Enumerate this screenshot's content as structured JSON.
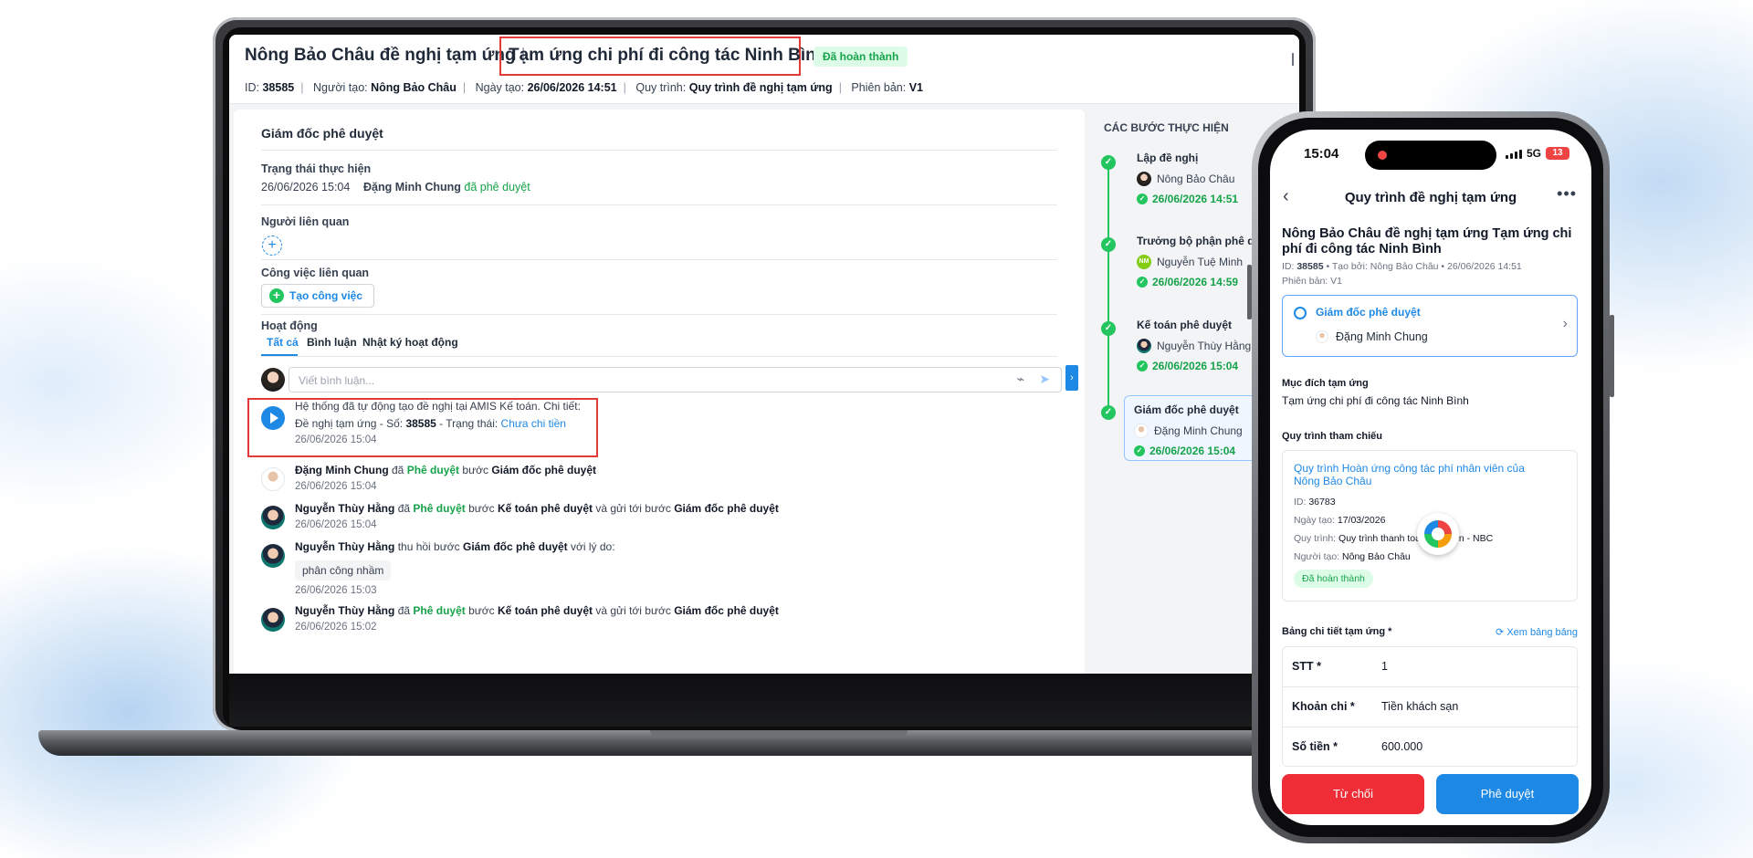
{
  "laptop": {
    "title_prefix": "Nông Bảo Châu đề nghị tạm ứng",
    "title_separator": "|",
    "title_highlight": "Tạm ứng chi phí đi công tác Ninh Bình",
    "status_badge": "Đã hoàn thành",
    "meta": {
      "id_label": "ID:",
      "id_value": "38585",
      "creator_label": "Người tạo:",
      "creator_value": "Nông Bảo Châu",
      "date_label": "Ngày tạo:",
      "date_value": "26/06/2026 14:51",
      "process_label": "Quy trình:",
      "process_value": "Quy trình đề nghị tạm ứng",
      "version_label": "Phiên bản:",
      "version_value": "V1"
    },
    "section_title": "Giám đốc phê duyệt",
    "status_label": "Trạng thái thực hiện",
    "status_time": "26/06/2026 15:04",
    "status_person": "Đặng Minh Chung",
    "status_action": "đã phê duyệt",
    "related_people_label": "Người liên quan",
    "add_symbol": "+",
    "related_tasks_label": "Công việc liên quan",
    "create_task_button": "Tạo công việc",
    "activity_label": "Hoạt động",
    "tabs": [
      "Tất cả",
      "Bình luận",
      "Nhật ký hoạt động"
    ],
    "comment_placeholder": "Viết bình luận...",
    "activities": [
      {
        "line1": "Hệ thống đã tự động tạo đề nghị tại AMIS Kế toán. Chi tiết:",
        "line2_prefix": "Đề nghị tạm ứng - Số:",
        "line2_number": "38585",
        "line2_mid": "- Trạng thái:",
        "line2_status": "Chưa chi tiền",
        "time": "26/06/2026 15:04"
      },
      {
        "person": "Đặng Minh Chung",
        "t1": "đã",
        "action": "Phê duyệt",
        "t2": "bước",
        "step": "Giám đốc phê duyệt",
        "t3": "",
        "step2": "",
        "time": "26/06/2026 15:04"
      },
      {
        "person": "Nguyễn Thùy Hằng",
        "t1": "đã",
        "action": "Phê duyệt",
        "t2": "bước",
        "step": "Kế toán phê duyệt",
        "t3": "và gửi tới bước",
        "step2": "Giám đốc phê duyệt",
        "time": "26/06/2026 15:04"
      },
      {
        "person": "Nguyễn Thùy Hằng",
        "t1": "thu hồi bước",
        "step": "Giám đốc phê duyệt",
        "t2": "với lý do:",
        "reason": "phân công nhầm",
        "time": "26/06/2026 15:03"
      },
      {
        "person": "Nguyễn Thùy Hằng",
        "t1": "đã",
        "action": "Phê duyệt",
        "t2": "bước",
        "step": "Kế toán phê duyệt",
        "t3": "và gửi tới bước",
        "step2": "Giám đốc phê duyệt",
        "time": "26/06/2026 15:02"
      }
    ],
    "steps_title": "CÁC BƯỚC THỰC HIỆN",
    "check_symbol": "✓",
    "steps": [
      {
        "title": "Lập đề nghị",
        "person": "Nông Bảo Châu",
        "time": "26/06/2026 14:51"
      },
      {
        "title": "Trưởng bộ phận phê duyệt",
        "person": "Nguyễn Tuệ Minh",
        "initials": "NM",
        "time": "26/06/2026 14:59"
      },
      {
        "title": "Kế toán phê duyệt",
        "person": "Nguyễn Thùy Hằng",
        "time": "26/06/2026 15:04"
      },
      {
        "title": "Giám đốc phê duyệt",
        "person": "Đặng Minh Chung",
        "time": "26/06/2026 15:04"
      }
    ]
  },
  "phone": {
    "clock": "15:04",
    "network": "5G",
    "battery": "13",
    "nav_title": "Quy trình đề nghị tạm ứng",
    "title": "Nông Bảo Châu đề nghị tạm ứng Tạm ứng chi phí đi công tác Ninh Bình",
    "meta_id_label": "ID:",
    "meta_id": "38585",
    "meta_rest": "• Tạo bởi: Nông Bảo Châu • 26/06/2026 14:51",
    "version": "Phiên bản: V1",
    "current_step": "Giám đốc phê duyệt",
    "current_person": "Đặng Minh Chung",
    "purpose_label": "Mục đích tạm ứng",
    "purpose_value": "Tạm ứng chi phí đi công tác Ninh Bình",
    "ref_label": "Quy trình tham chiếu",
    "ref": {
      "link": "Quy trình Hoàn ứng công tác phí nhân viên của Nông Bảo Châu",
      "id_label": "ID:",
      "id": "36783",
      "date_label": "Ngày tạo:",
      "date": "17/03/2026",
      "process_label": "Quy trình:",
      "process": "Quy trình thanh toán hóa đơn - NBC",
      "creator_label": "Người tạo:",
      "creator": "Nông Bảo Châu",
      "status": "Đã hoàn thành"
    },
    "table_title": "Bảng chi tiết tạm ứng *",
    "table_action": "Xem bảng bảng",
    "table_rows": [
      {
        "key": "STT *",
        "value": "1"
      },
      {
        "key": "Khoản chi *",
        "value": "Tiền khách sạn"
      },
      {
        "key": "Số tiền *",
        "value": "600.000"
      }
    ],
    "reject_button": "Từ chối",
    "approve_button": "Phê duyệt"
  }
}
